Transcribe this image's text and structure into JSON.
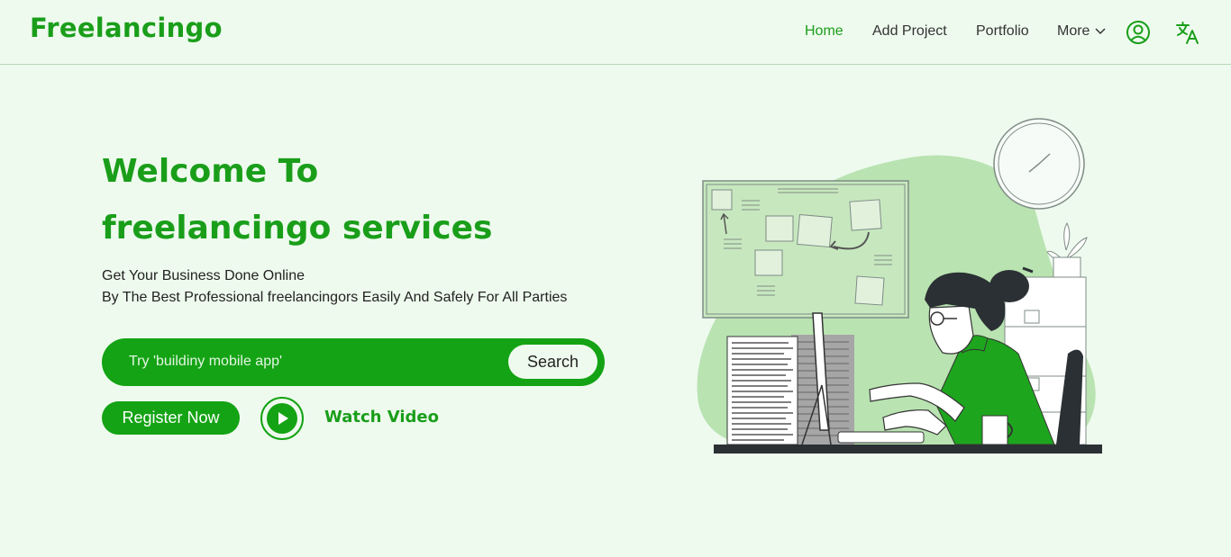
{
  "brand": {
    "name": "Freelancingo"
  },
  "nav": {
    "items": [
      {
        "label": "Home",
        "active": true
      },
      {
        "label": "Add Project",
        "active": false
      },
      {
        "label": "Portfolio",
        "active": false
      },
      {
        "label": "More",
        "active": false
      }
    ],
    "icons": [
      "chevron-down-icon",
      "user-circle-icon",
      "translate-icon"
    ]
  },
  "hero": {
    "title_line1": "Welcome To",
    "title_line2": "freelancingo services",
    "subtitle_line1": "Get Your Business Done Online",
    "subtitle_line2": "By The Best Professional freelancingors Easily And Safely For All Parties"
  },
  "search": {
    "placeholder": "Try 'buildiny mobile app'",
    "value": "",
    "button_label": "Search"
  },
  "actions": {
    "register_label": "Register Now",
    "watch_label": "Watch Video"
  },
  "colors": {
    "accent": "#1a9e1a",
    "button_green": "#14a314",
    "background": "#eefaee",
    "blob": "#b9e3b1"
  }
}
